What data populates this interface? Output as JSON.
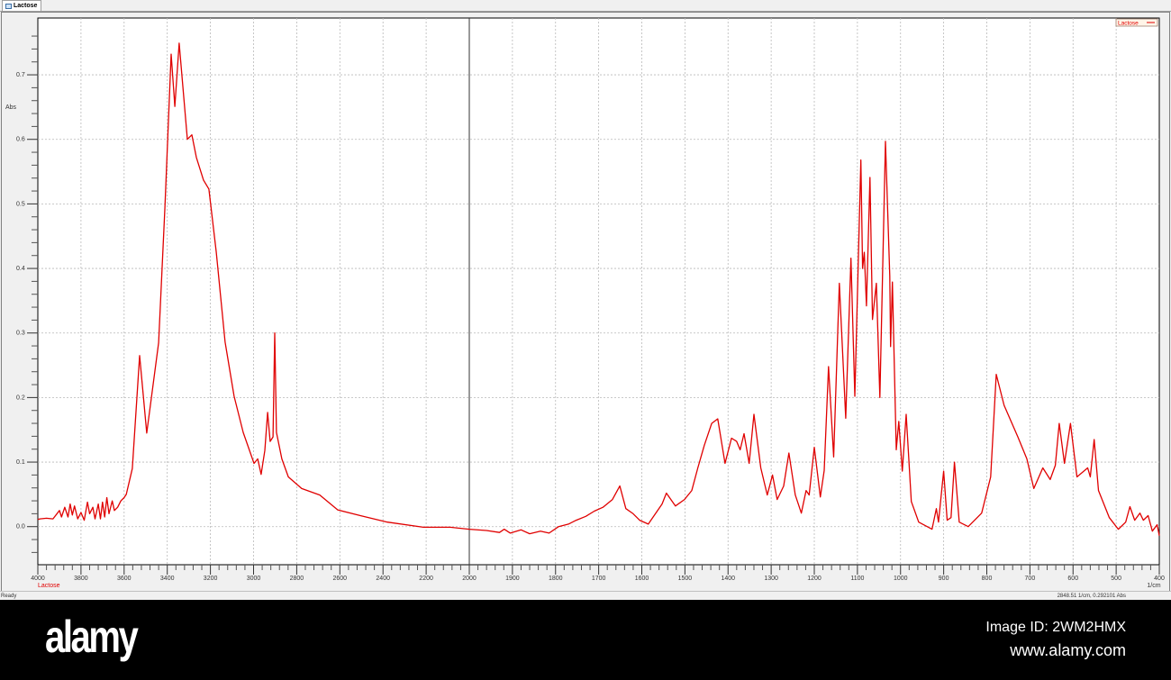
{
  "tab": {
    "label": "Lactose"
  },
  "status": {
    "left": "Ready",
    "coordinate": "2848.51 1/cm, 0.292101 Abs"
  },
  "watermark": {
    "logo": "alamy",
    "image_id": "Image ID: 2WM2HMX",
    "url": "www.alamy.com"
  },
  "colors": {
    "series": "#e00000",
    "grid": "#b8b8b8",
    "legend_bg": "#fff5e8"
  },
  "chart_data": {
    "type": "line",
    "title": "",
    "xlabel": "1/cm",
    "ylabel": "Abs",
    "xlim": [
      4000,
      400
    ],
    "x_scale_break": 2000,
    "ylim": [
      -0.059,
      0.788
    ],
    "grid": true,
    "legend": {
      "placement": "top-right",
      "entries": [
        "Lactose"
      ]
    },
    "series_label_below_axis": "Lactose",
    "x_ticks": [
      4000,
      3800,
      3600,
      3400,
      3200,
      3000,
      2800,
      2600,
      2400,
      2200,
      2000,
      1900,
      1800,
      1700,
      1600,
      1500,
      1400,
      1300,
      1200,
      1100,
      1000,
      900,
      800,
      700,
      600,
      500,
      400
    ],
    "y_ticks": [
      "0.0",
      "0.1",
      "0.2",
      "0.3",
      "0.4",
      "0.5",
      "0.6",
      "0.7"
    ],
    "series": [
      {
        "name": "Lactose",
        "points": [
          [
            4000,
            0.011
          ],
          [
            3990,
            0.012
          ],
          [
            3960,
            0.013
          ],
          [
            3930,
            0.012
          ],
          [
            3900,
            0.025
          ],
          [
            3890,
            0.015
          ],
          [
            3875,
            0.03
          ],
          [
            3860,
            0.015
          ],
          [
            3850,
            0.035
          ],
          [
            3840,
            0.018
          ],
          [
            3830,
            0.032
          ],
          [
            3815,
            0.012
          ],
          [
            3800,
            0.022
          ],
          [
            3785,
            0.01
          ],
          [
            3770,
            0.038
          ],
          [
            3760,
            0.02
          ],
          [
            3745,
            0.03
          ],
          [
            3735,
            0.012
          ],
          [
            3720,
            0.035
          ],
          [
            3710,
            0.012
          ],
          [
            3700,
            0.038
          ],
          [
            3690,
            0.015
          ],
          [
            3680,
            0.045
          ],
          [
            3670,
            0.02
          ],
          [
            3655,
            0.04
          ],
          [
            3645,
            0.025
          ],
          [
            3630,
            0.03
          ],
          [
            3615,
            0.04
          ],
          [
            3600,
            0.045
          ],
          [
            3590,
            0.05
          ],
          [
            3562,
            0.09
          ],
          [
            3528,
            0.265
          ],
          [
            3495,
            0.145
          ],
          [
            3440,
            0.285
          ],
          [
            3411,
            0.495
          ],
          [
            3382,
            0.732
          ],
          [
            3365,
            0.651
          ],
          [
            3345,
            0.749
          ],
          [
            3307,
            0.6
          ],
          [
            3286,
            0.607
          ],
          [
            3265,
            0.572
          ],
          [
            3232,
            0.537
          ],
          [
            3207,
            0.523
          ],
          [
            3173,
            0.425
          ],
          [
            3132,
            0.286
          ],
          [
            3090,
            0.202
          ],
          [
            3048,
            0.146
          ],
          [
            2998,
            0.098
          ],
          [
            2981,
            0.105
          ],
          [
            2965,
            0.081
          ],
          [
            2948,
            0.118
          ],
          [
            2935,
            0.177
          ],
          [
            2923,
            0.132
          ],
          [
            2910,
            0.139
          ],
          [
            2902,
            0.3
          ],
          [
            2894,
            0.146
          ],
          [
            2869,
            0.105
          ],
          [
            2839,
            0.077
          ],
          [
            2777,
            0.059
          ],
          [
            2693,
            0.049
          ],
          [
            2610,
            0.026
          ],
          [
            2505,
            0.017
          ],
          [
            2380,
            0.007
          ],
          [
            2213,
            -0.001
          ],
          [
            2088,
            -0.001
          ],
          [
            2000,
            -0.004
          ],
          [
            1960,
            -0.006
          ],
          [
            1930,
            -0.009
          ],
          [
            1919,
            -0.004
          ],
          [
            1905,
            -0.01
          ],
          [
            1880,
            -0.005
          ],
          [
            1860,
            -0.011
          ],
          [
            1835,
            -0.007
          ],
          [
            1815,
            -0.01
          ],
          [
            1793,
            0.0
          ],
          [
            1770,
            0.004
          ],
          [
            1752,
            0.01
          ],
          [
            1730,
            0.016
          ],
          [
            1710,
            0.024
          ],
          [
            1690,
            0.03
          ],
          [
            1668,
            0.042
          ],
          [
            1651,
            0.063
          ],
          [
            1637,
            0.028
          ],
          [
            1620,
            0.02
          ],
          [
            1605,
            0.01
          ],
          [
            1585,
            0.004
          ],
          [
            1553,
            0.035
          ],
          [
            1543,
            0.052
          ],
          [
            1522,
            0.032
          ],
          [
            1501,
            0.042
          ],
          [
            1484,
            0.056
          ],
          [
            1470,
            0.091
          ],
          [
            1455,
            0.126
          ],
          [
            1438,
            0.16
          ],
          [
            1424,
            0.167
          ],
          [
            1407,
            0.098
          ],
          [
            1392,
            0.137
          ],
          [
            1380,
            0.132
          ],
          [
            1372,
            0.119
          ],
          [
            1363,
            0.144
          ],
          [
            1351,
            0.098
          ],
          [
            1340,
            0.174
          ],
          [
            1324,
            0.091
          ],
          [
            1309,
            0.049
          ],
          [
            1297,
            0.08
          ],
          [
            1286,
            0.042
          ],
          [
            1271,
            0.063
          ],
          [
            1259,
            0.114
          ],
          [
            1244,
            0.049
          ],
          [
            1230,
            0.021
          ],
          [
            1219,
            0.056
          ],
          [
            1212,
            0.049
          ],
          [
            1200,
            0.123
          ],
          [
            1186,
            0.046
          ],
          [
            1177,
            0.087
          ],
          [
            1167,
            0.248
          ],
          [
            1155,
            0.108
          ],
          [
            1142,
            0.377
          ],
          [
            1127,
            0.168
          ],
          [
            1115,
            0.416
          ],
          [
            1106,
            0.202
          ],
          [
            1092,
            0.568
          ],
          [
            1088,
            0.4
          ],
          [
            1084,
            0.425
          ],
          [
            1079,
            0.342
          ],
          [
            1071,
            0.541
          ],
          [
            1065,
            0.321
          ],
          [
            1056,
            0.377
          ],
          [
            1048,
            0.2
          ],
          [
            1035,
            0.597
          ],
          [
            1025,
            0.388
          ],
          [
            1023,
            0.279
          ],
          [
            1019,
            0.379
          ],
          [
            1010,
            0.119
          ],
          [
            1004,
            0.163
          ],
          [
            996,
            0.086
          ],
          [
            987,
            0.174
          ],
          [
            975,
            0.039
          ],
          [
            958,
            0.007
          ],
          [
            927,
            -0.004
          ],
          [
            917,
            0.028
          ],
          [
            912,
            0.007
          ],
          [
            900,
            0.086
          ],
          [
            892,
            0.01
          ],
          [
            883,
            0.014
          ],
          [
            875,
            0.1
          ],
          [
            864,
            0.007
          ],
          [
            843,
            0.0
          ],
          [
            812,
            0.021
          ],
          [
            791,
            0.077
          ],
          [
            778,
            0.236
          ],
          [
            760,
            0.188
          ],
          [
            728,
            0.139
          ],
          [
            707,
            0.105
          ],
          [
            691,
            0.059
          ],
          [
            670,
            0.091
          ],
          [
            653,
            0.073
          ],
          [
            641,
            0.095
          ],
          [
            632,
            0.16
          ],
          [
            620,
            0.098
          ],
          [
            606,
            0.16
          ],
          [
            591,
            0.077
          ],
          [
            566,
            0.091
          ],
          [
            560,
            0.077
          ],
          [
            551,
            0.135
          ],
          [
            541,
            0.056
          ],
          [
            516,
            0.014
          ],
          [
            495,
            -0.004
          ],
          [
            478,
            0.007
          ],
          [
            468,
            0.031
          ],
          [
            457,
            0.01
          ],
          [
            445,
            0.021
          ],
          [
            437,
            0.01
          ],
          [
            426,
            0.017
          ],
          [
            416,
            -0.007
          ],
          [
            405,
            0.003
          ],
          [
            400,
            -0.014
          ]
        ]
      }
    ]
  }
}
